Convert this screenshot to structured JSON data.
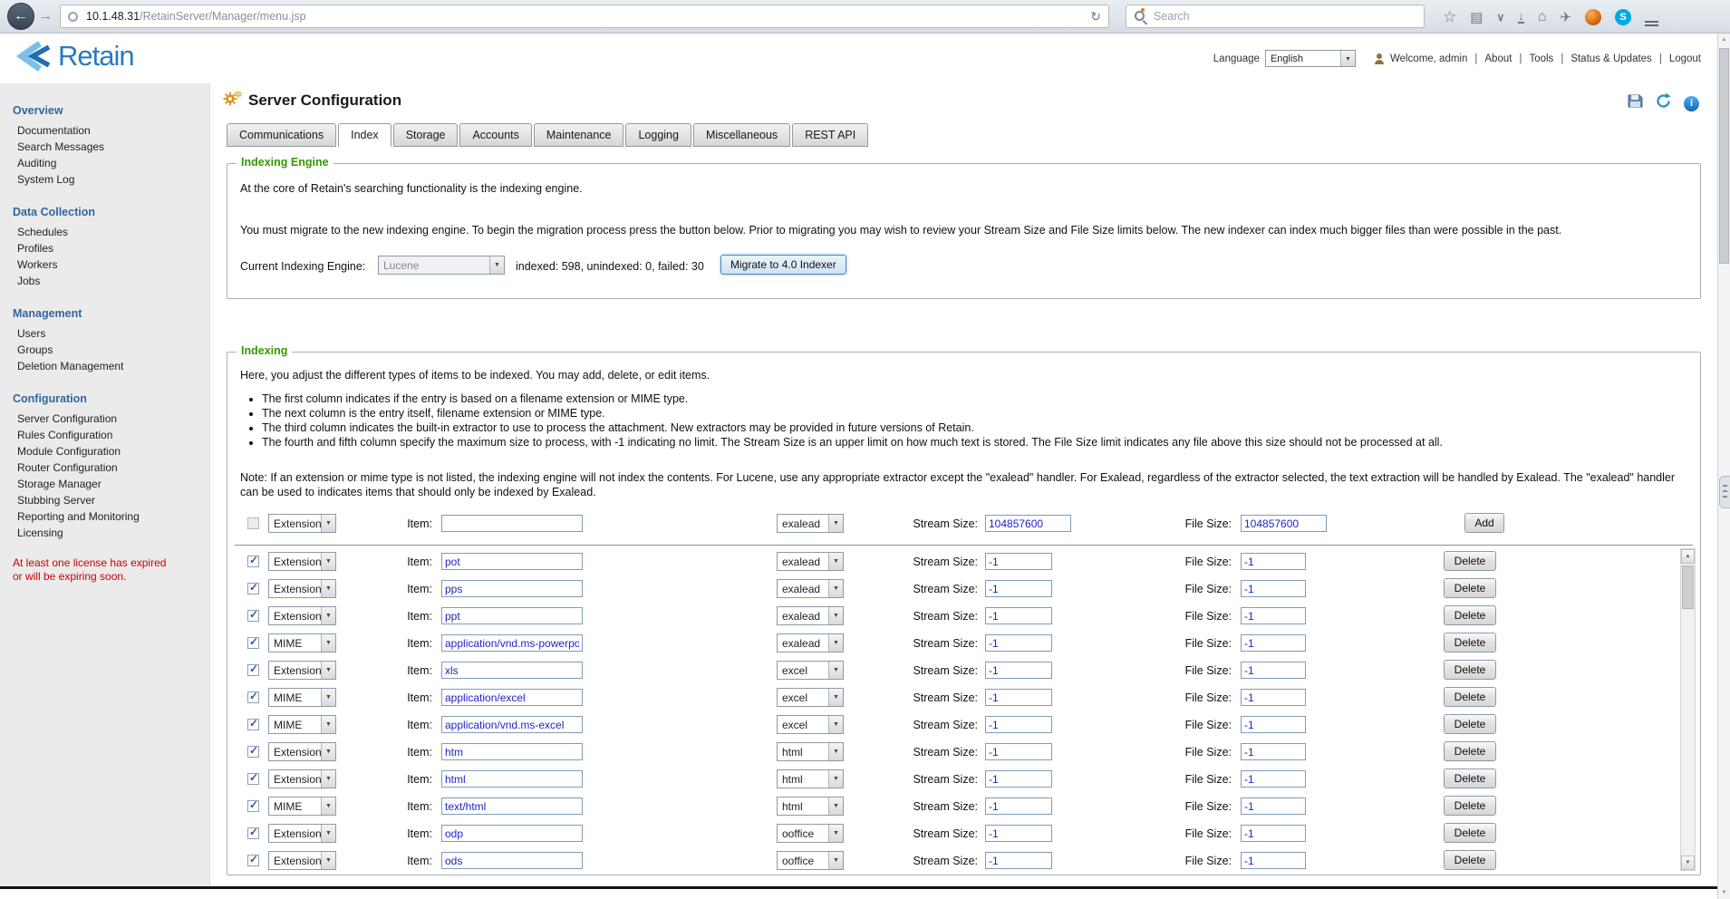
{
  "browser": {
    "url_domain": "10.1.48.31",
    "url_path": "/RetainServer/Manager/menu.jsp",
    "search_placeholder": "Search"
  },
  "icons": {
    "back": "←",
    "forward": "→",
    "reload": "↻",
    "star": "☆",
    "reading_list": "▤",
    "pocket": "∨",
    "download": "↓",
    "home": "⌂",
    "share": "✈",
    "skype_letter": "S",
    "info_letter": "i",
    "arrow_up": "▲",
    "arrow_down": "▼",
    "select_arrow": "▼"
  },
  "header": {
    "logo_text": "Retain",
    "language_label": "Language",
    "language_value": "English",
    "welcome": "Welcome, admin",
    "sep": "|",
    "links": [
      "About",
      "Tools",
      "Status & Updates",
      "Logout"
    ]
  },
  "page": {
    "title": "Server Configuration"
  },
  "sidebar": {
    "sections": [
      {
        "heading": "Overview",
        "items": [
          "Documentation",
          "Search Messages",
          "Auditing",
          "System Log"
        ]
      },
      {
        "heading": "Data Collection",
        "items": [
          "Schedules",
          "Profiles",
          "Workers",
          "Jobs"
        ]
      },
      {
        "heading": "Management",
        "items": [
          "Users",
          "Groups",
          "Deletion Management"
        ]
      },
      {
        "heading": "Configuration",
        "items": [
          "Server Configuration",
          "Rules Configuration",
          "Module Configuration",
          "Router Configuration",
          "Storage Manager",
          "Stubbing Server",
          "Reporting and Monitoring",
          "Licensing"
        ]
      }
    ],
    "warning": "At least one license has expired or will be expiring soon."
  },
  "tabs": [
    "Communications",
    "Index",
    "Storage",
    "Accounts",
    "Maintenance",
    "Logging",
    "Miscellaneous",
    "REST API"
  ],
  "active_tab": "Index",
  "engine": {
    "legend": "Indexing Engine",
    "p1": "At the core of Retain's searching functionality is the indexing engine.",
    "p2": "You must migrate to the new indexing engine. To begin the migration process press the button below. Prior to migrating you may wish to review your Stream Size and File Size limits below. The new indexer can index much bigger files than were possible in the past.",
    "current_label": "Current Indexing Engine:",
    "engine_value": "Lucene",
    "stats": "indexed: 598, unindexed: 0, failed: 30",
    "migrate_button": "Migrate to 4.0 Indexer"
  },
  "indexing": {
    "legend": "Indexing",
    "intro": "Here, you adjust the different types of items to be indexed. You may add, delete, or edit items.",
    "bullets": [
      "The first column indicates if the entry is based on a filename extension or MIME type.",
      "The next column is the entry itself, filename extension or MIME type.",
      "The third column indicates the built-in extractor to use to process the attachment. New extractors may be provided in future versions of Retain.",
      "The fourth and fifth column specify the maximum size to process, with -1 indicating no limit. The Stream Size is an upper limit on how much text is stored. The File Size limit indicates any file above this size should not be processed at all."
    ],
    "note": "Note: If an extension or mime type is not listed, the indexing engine will not index the contents. For Lucene, use any appropriate extractor except the \"exalead\" handler. For Exalead, regardless of the extractor selected, the text extraction will be handled by Exalead. The \"exalead\" handler can be used to indicates items that should only be indexed by Exalead.",
    "labels": {
      "item": "Item:",
      "stream": "Stream Size:",
      "file": "File Size:"
    },
    "add_row": {
      "type": "Extension",
      "item": "",
      "extractor": "exalead",
      "stream": "104857600",
      "file": "104857600",
      "button": "Add"
    },
    "delete_label": "Delete",
    "rows": [
      {
        "type": "Extension",
        "item": "pot",
        "extractor": "exalead",
        "stream": "-1",
        "file": "-1"
      },
      {
        "type": "Extension",
        "item": "pps",
        "extractor": "exalead",
        "stream": "-1",
        "file": "-1"
      },
      {
        "type": "Extension",
        "item": "ppt",
        "extractor": "exalead",
        "stream": "-1",
        "file": "-1"
      },
      {
        "type": "MIME",
        "item": "application/vnd.ms-powerpoint",
        "extractor": "exalead",
        "stream": "-1",
        "file": "-1"
      },
      {
        "type": "Extension",
        "item": "xls",
        "extractor": "excel",
        "stream": "-1",
        "file": "-1"
      },
      {
        "type": "MIME",
        "item": "application/excel",
        "extractor": "excel",
        "stream": "-1",
        "file": "-1"
      },
      {
        "type": "MIME",
        "item": "application/vnd.ms-excel",
        "extractor": "excel",
        "stream": "-1",
        "file": "-1"
      },
      {
        "type": "Extension",
        "item": "htm",
        "extractor": "html",
        "stream": "-1",
        "file": "-1"
      },
      {
        "type": "Extension",
        "item": "html",
        "extractor": "html",
        "stream": "-1",
        "file": "-1"
      },
      {
        "type": "MIME",
        "item": "text/html",
        "extractor": "html",
        "stream": "-1",
        "file": "-1"
      },
      {
        "type": "Extension",
        "item": "odp",
        "extractor": "ooffice",
        "stream": "-1",
        "file": "-1"
      },
      {
        "type": "Extension",
        "item": "ods",
        "extractor": "ooffice",
        "stream": "-1",
        "file": "-1"
      }
    ]
  },
  "colors": {
    "accent_blue": "#2a7abf",
    "legend_green": "#339900",
    "warning_red": "#cc0000",
    "value_blue": "#2222cc"
  }
}
